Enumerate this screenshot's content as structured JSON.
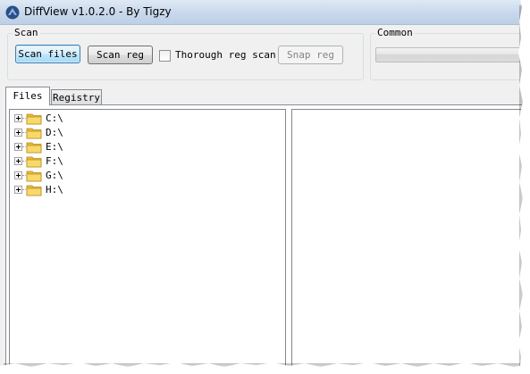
{
  "window": {
    "title": "DiffView v1.0.2.0 - By Tigzy",
    "icon": "app-logo-icon"
  },
  "scan_group": {
    "label": "Scan",
    "scan_files_label": "Scan files",
    "scan_reg_label": "Scan reg",
    "thorough_label": "Thorough reg scan",
    "thorough_checked": false,
    "snap_reg_label": "Snap reg",
    "snap_reg_enabled": false
  },
  "common_group": {
    "label": "Common",
    "progress": 0
  },
  "tabs": [
    {
      "label": "Files",
      "active": true
    },
    {
      "label": "Registry",
      "active": false
    }
  ],
  "tree": {
    "items": [
      {
        "label": "C:\\",
        "icon": "folder-icon"
      },
      {
        "label": "D:\\",
        "icon": "folder-icon"
      },
      {
        "label": "E:\\",
        "icon": "folder-icon"
      },
      {
        "label": "F:\\",
        "icon": "folder-icon"
      },
      {
        "label": "G:\\",
        "icon": "folder-icon"
      },
      {
        "label": "H:\\",
        "icon": "folder-icon"
      }
    ]
  },
  "colors": {
    "titlebar": "#cad9ec",
    "folder": "#f5d35e",
    "focus_border": "#3c7fb1"
  }
}
